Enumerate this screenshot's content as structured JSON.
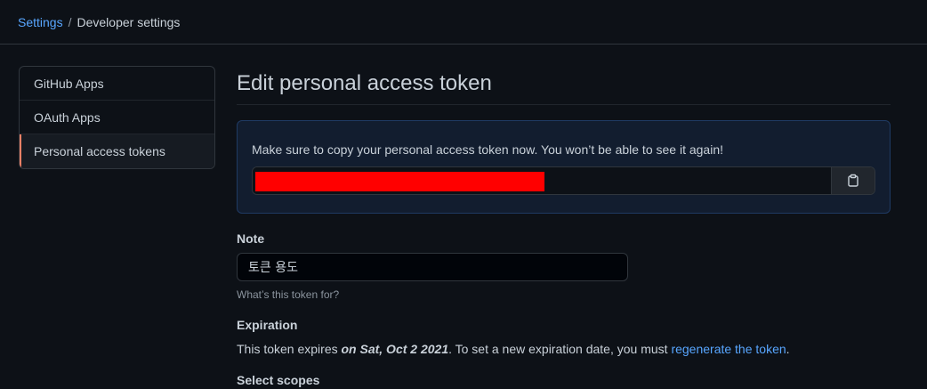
{
  "breadcrumb": {
    "root": "Settings",
    "separator": "/",
    "current": "Developer settings"
  },
  "sidebar": {
    "items": [
      {
        "label": "GitHub Apps",
        "active": false
      },
      {
        "label": "OAuth Apps",
        "active": false
      },
      {
        "label": "Personal access tokens",
        "active": true
      }
    ]
  },
  "main": {
    "title": "Edit personal access token",
    "flash": {
      "message": "Make sure to copy your personal access token now. You won’t be able to see it again!",
      "copy_icon": "clipboard-icon"
    },
    "note": {
      "label": "Note",
      "value": "토큰 용도",
      "hint": "What’s this token for?"
    },
    "expiration": {
      "label": "Expiration",
      "text_before": "This token expires ",
      "date": "on Sat, Oct 2 2021",
      "text_middle": ". To set a new expiration date, you must ",
      "link": "regenerate the token",
      "text_after": "."
    },
    "scopes_label": "Select scopes"
  },
  "colors": {
    "background": "#0d1117",
    "link": "#58a6ff",
    "active_indicator": "#f78166",
    "flash_bg": "#121d2f",
    "redaction": "#ff0000"
  }
}
